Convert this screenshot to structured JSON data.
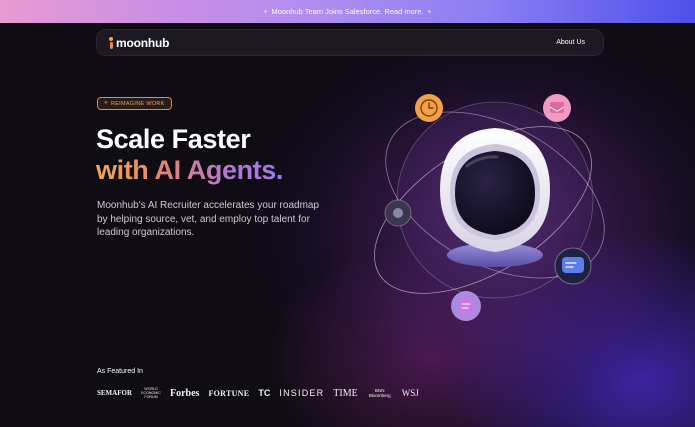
{
  "announcement": {
    "text": "Moonhub Team Joins Salesforce. Read more."
  },
  "nav": {
    "logo_text": "moonhub",
    "about_label": "About Us"
  },
  "hero": {
    "badge": "REIMAGINE WORK",
    "headline_line1": "Scale Faster",
    "headline_line2": "with AI Agents.",
    "subtitle": "Moonhub's AI Recruiter accelerates your roadmap by helping source, vet, and employ top talent for leading organizations."
  },
  "featured": {
    "label": "As Featured In",
    "logos": {
      "semafor": "SEMAFOR",
      "wef": "WORLD ECONOMIC FORUM",
      "forbes": "Forbes",
      "fortune": "FORTUNE",
      "techcrunch": "TC",
      "insider": "INSIDER",
      "time": "TIME",
      "bnn": "BNN Bloomberg",
      "wsj": "WSJ"
    }
  },
  "colors": {
    "accent_orange": "#e8883a",
    "banner_start": "#e89bd2",
    "banner_end": "#4d50ea",
    "nav_bg": "#1e1b24"
  },
  "icons": [
    "sparkle-icon",
    "clock-icon",
    "inbox-icon",
    "chat-icon",
    "document-icon",
    "message-icon",
    "astronaut-helmet-illustration"
  ]
}
